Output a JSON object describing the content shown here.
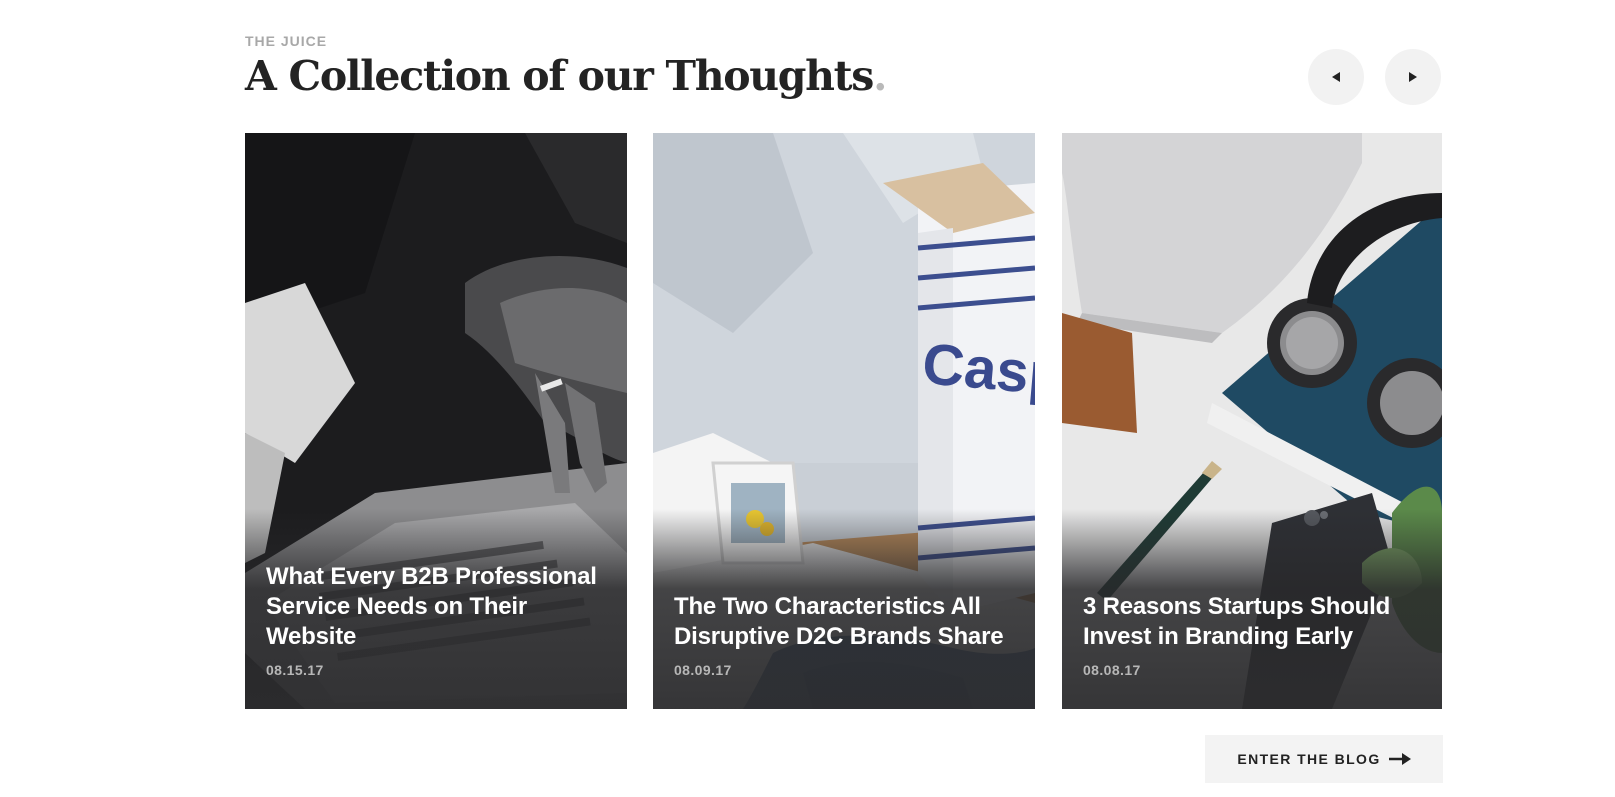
{
  "section": {
    "eyebrow": "THE JUICE",
    "heading": "A Collection of our Thoughts",
    "heading_dot": "."
  },
  "carousel": {
    "prev_icon": "caret-left-icon",
    "next_icon": "caret-right-icon"
  },
  "posts": [
    {
      "title": "What Every B2B Professional Service Needs on Their Website",
      "date": "08.15.17",
      "image": "laptop-typing-photo"
    },
    {
      "title": "The Two Characteristics All Disruptive D2C Brands Share",
      "date": "08.09.17",
      "image": "casper-box-bedroom-photo"
    },
    {
      "title": "3 Reasons Startups Should Invest in Branding Early",
      "date": "08.08.17",
      "image": "desk-headphones-phone-photo"
    }
  ],
  "cta": {
    "label": "ENTER THE BLOG",
    "icon": "arrow-right-icon"
  },
  "colors": {
    "heading": "#232323",
    "eyebrow": "#a8a8a8",
    "button_bg": "#f2f2f2",
    "card_title": "#ffffff",
    "card_date": "#b7b7b7"
  }
}
